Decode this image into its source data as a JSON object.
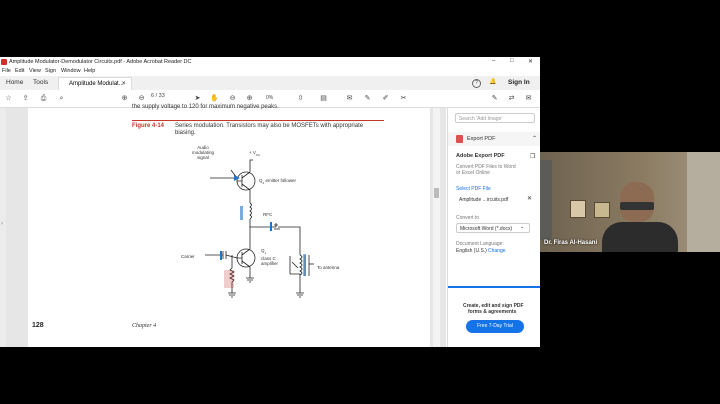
{
  "window": {
    "title": "Amplitude Modulator-Demodulator Circuits.pdf - Adobe Acrobat Reader DC"
  },
  "window_controls": {
    "min": "–",
    "max": "□",
    "close": "✕"
  },
  "menu": [
    "File",
    "Edit",
    "View",
    "Sign",
    "Window",
    "Help"
  ],
  "tabs": {
    "home": "Home",
    "tools": "Tools",
    "doc": "Amplitude Modulat...",
    "close": "×"
  },
  "header_right": {
    "help": "?",
    "bell": "🔔",
    "signin": "Sign In"
  },
  "toolbar": {
    "page_current": "6",
    "page_total": "/ 33",
    "zoom": "0%"
  },
  "document": {
    "top_line": "the supply voltage to 120 for maximum negative peaks.",
    "figure_label": "Figure 4-14",
    "caption_line1": "Series modulation. Transistors may also be MOSFETs with appropriate",
    "caption_line2": "biasing.",
    "audio_label_1": "Audio",
    "audio_label_2": "modulating",
    "audio_label_3": "signal",
    "vcc": "+ V",
    "vcc_sub": "CC",
    "q2_label": "Q",
    "q2_sub": "2",
    "q2_desc": "emitter follower",
    "rfc": "RFC",
    "q1_label": "Q",
    "q1_sub": "1",
    "q1_desc1": "class C",
    "q1_desc2": "amplifier",
    "carrier": "Carrier",
    "antenna": "To antenna",
    "page_number": "128",
    "chapter": "Chapter 4"
  },
  "right_panel": {
    "search_placeholder": "Search 'Add Image'",
    "export_pdf": "Export PDF",
    "adobe_export_title": "Adobe Export PDF",
    "convert_desc1": "Convert PDF Files to Word",
    "convert_desc2": "or Excel Online",
    "select_pdf": "Select PDF File",
    "file_name": "Amplitude ...ircuits.pdf",
    "convert_to": "Convert to",
    "format": "Microsoft Word (*.docx)",
    "doc_language": "Document Language:",
    "language": "English (U.S.)",
    "change": "Change",
    "promo1": "Create, edit and sign PDF",
    "promo2": "forms & agreements",
    "free_trial": "Free 7-Day Trial"
  },
  "webcam": {
    "name": "Dr. Firas Al-Hasani"
  }
}
